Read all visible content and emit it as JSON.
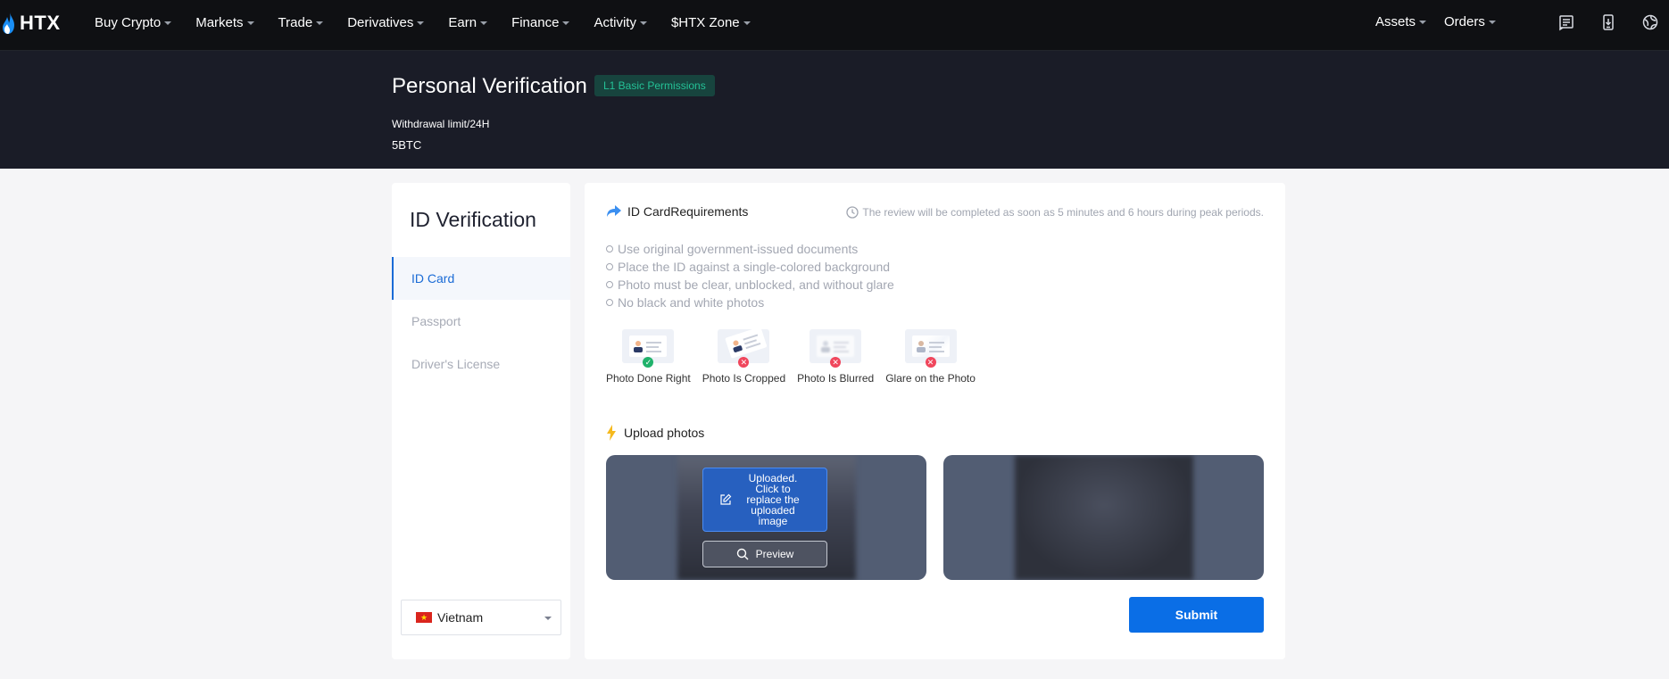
{
  "topnav": {
    "logo": "HTX",
    "items": [
      {
        "label": "Buy Crypto"
      },
      {
        "label": "Markets"
      },
      {
        "label": "Trade"
      },
      {
        "label": "Derivatives"
      },
      {
        "label": "Earn"
      },
      {
        "label": "Finance"
      },
      {
        "label": "Activity"
      },
      {
        "label": "$HTX Zone"
      }
    ],
    "assets_label": "Assets",
    "orders_label": "Orders",
    "icons": [
      "announcement-icon",
      "download-app-icon",
      "language-globe-icon"
    ]
  },
  "hero": {
    "title": "Personal Verification",
    "badge": "L1 Basic Permissions",
    "limit_label": "Withdrawal limit/24H",
    "limit_value": "5BTC"
  },
  "sidebar": {
    "title": "ID Verification",
    "items": [
      {
        "label": "ID Card",
        "active": true
      },
      {
        "label": "Passport",
        "active": false
      },
      {
        "label": "Driver's License",
        "active": false
      }
    ],
    "country": "Vietnam"
  },
  "main": {
    "requirements_title": "ID CardRequirements",
    "review_note": "The review will be completed as soon as 5 minutes and 6 hours during peak periods.",
    "requirements": [
      "Use original government-issued documents",
      "Place the ID against a single-colored background",
      "Photo must be clear, unblocked, and without glare",
      "No black and white photos"
    ],
    "samples": [
      {
        "label": "Photo Done Right",
        "status": "ok"
      },
      {
        "label": "Photo Is Cropped",
        "status": "bad"
      },
      {
        "label": "Photo Is Blurred",
        "status": "bad"
      },
      {
        "label": "Glare on the Photo",
        "status": "bad"
      }
    ],
    "upload_title": "Upload photos",
    "uploaded_label": "Uploaded. Click to replace the uploaded image",
    "preview_label": "Preview",
    "submit_label": "Submit"
  },
  "colors": {
    "accent": "#0a6ee6",
    "nav_bg": "#0f1013",
    "hero_bg": "#1a1c27",
    "badge_text": "#24c196",
    "ok": "#20b26b",
    "bad": "#f0465c"
  }
}
